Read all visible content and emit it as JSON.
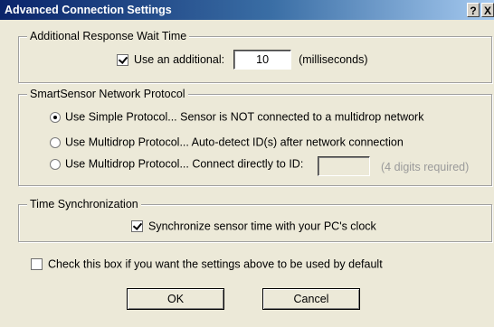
{
  "window": {
    "title": "Advanced Connection Settings",
    "help_label": "?",
    "close_label": "X"
  },
  "wait_group": {
    "legend": "Additional Response Wait Time",
    "checkbox_label": "Use an additional:",
    "checkbox_checked": true,
    "value": "10",
    "unit": "(milliseconds)"
  },
  "protocol_group": {
    "legend": "SmartSensor Network Protocol",
    "options": [
      {
        "label": "Use Simple Protocol... Sensor is NOT connected to a multidrop network",
        "selected": true
      },
      {
        "label": "Use Multidrop Protocol... Auto-detect ID(s) after network connection",
        "selected": false
      },
      {
        "label": "Use Multidrop Protocol... Connect directly to ID:",
        "selected": false
      }
    ],
    "id_value": "",
    "id_hint": "(4 digits required)"
  },
  "time_group": {
    "legend": "Time Synchronization",
    "checkbox_label": "Synchronize sensor time with your PC's clock",
    "checkbox_checked": true
  },
  "default_checkbox": {
    "label": "Check this box if you want the settings above to be used by default",
    "checked": false
  },
  "buttons": {
    "ok": "OK",
    "cancel": "Cancel"
  }
}
